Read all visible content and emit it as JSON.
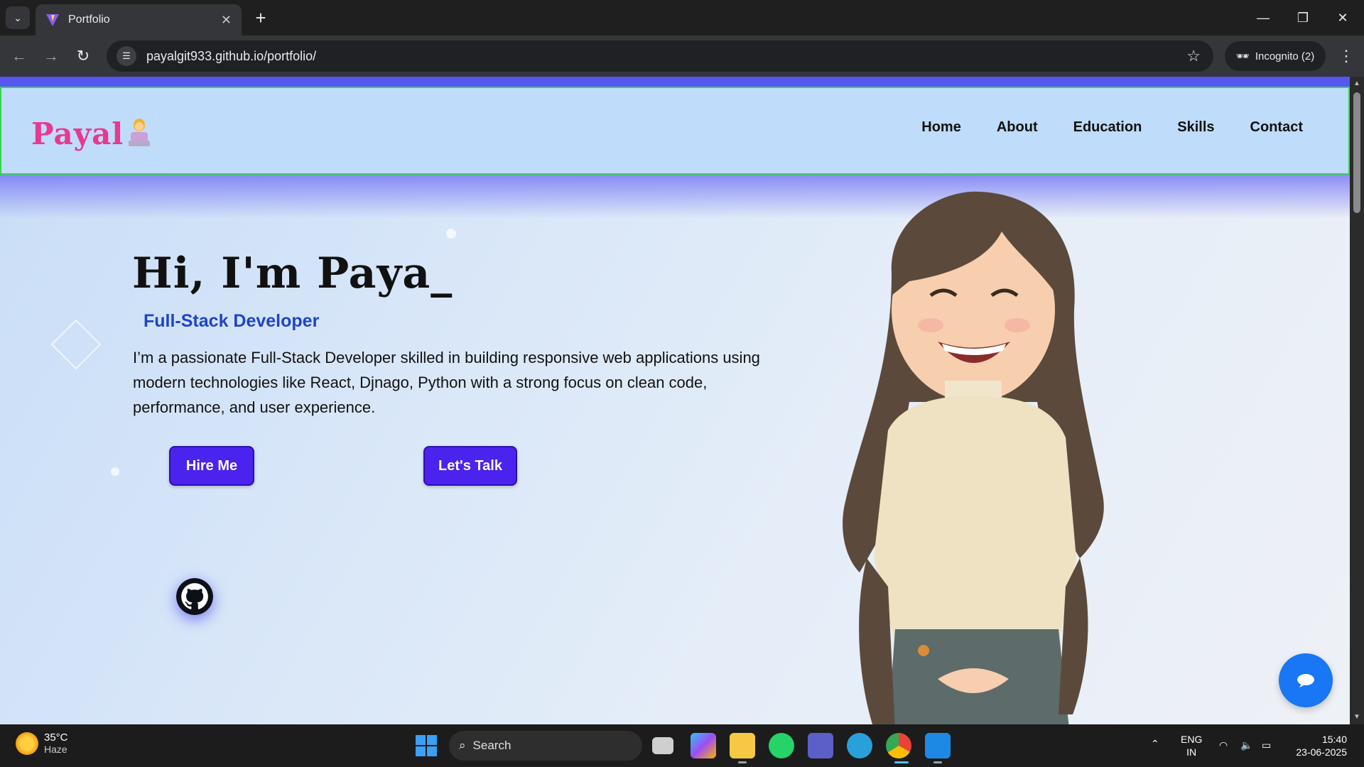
{
  "browser": {
    "tab_title": "Portfolio",
    "url": "payalgit933.github.io/portfolio/",
    "incognito_label": "Incognito (2)"
  },
  "site": {
    "logo_text": "Payal",
    "logo_emoji": "person-at-laptop-emoji",
    "nav": [
      "Home",
      "About",
      "Education",
      "Skills",
      "Contact"
    ],
    "hero": {
      "greeting": "Hi, I'm Paya_",
      "role": "Full-Stack Developer",
      "bio": "I’m a passionate Full-Stack Developer skilled in building responsive web applications using modern technologies like React, Djnago, Python with a strong focus on clean code, performance, and user experience.",
      "hire_button": "Hire Me",
      "talk_button": "Let's Talk"
    },
    "icons": {
      "github": "github-icon",
      "chat": "chat-bubble-icon"
    },
    "colors": {
      "logo": "#e8388f",
      "role": "#1f44c6",
      "button": "#4b22ee",
      "nav_border": "#33d64a",
      "chat_button": "#1976f5"
    }
  },
  "taskbar": {
    "weather_temp": "35°C",
    "weather_desc": "Haze",
    "search_placeholder": "Search",
    "lang_top": "ENG",
    "lang_bottom": "IN",
    "time": "15:40",
    "date": "23-06-2025"
  }
}
